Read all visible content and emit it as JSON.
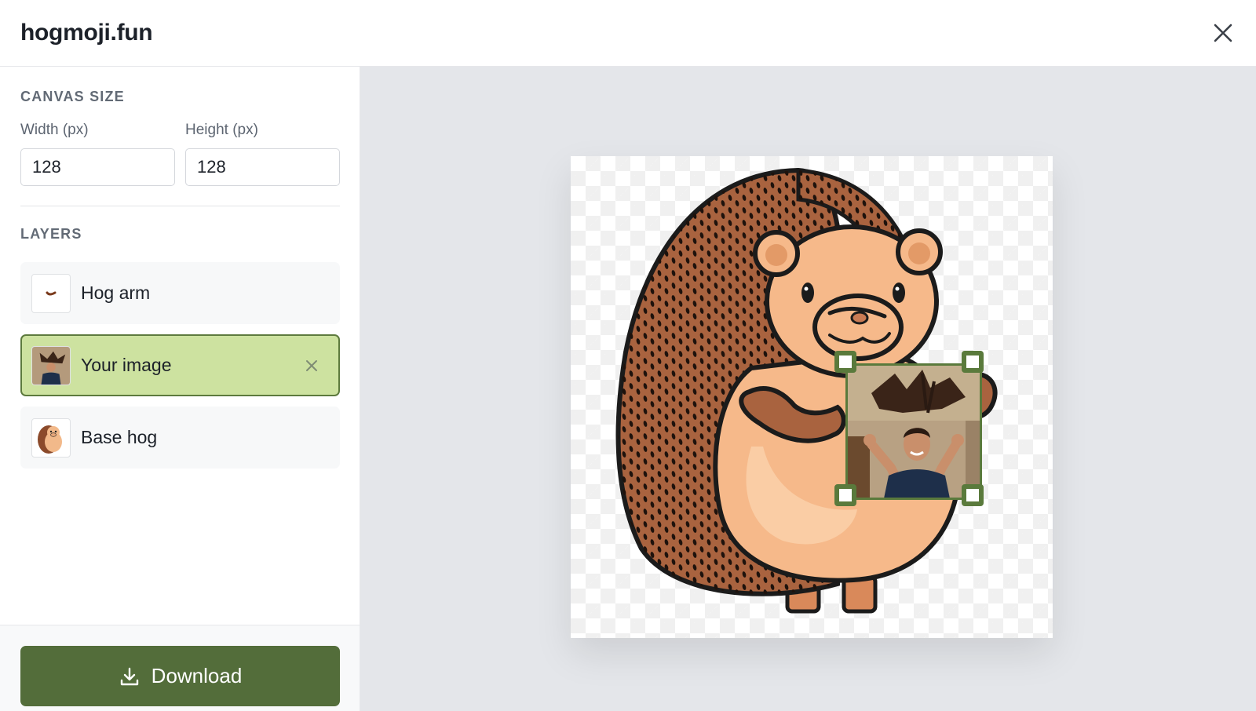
{
  "header": {
    "title": "hogmoji.fun",
    "close_icon": "close-icon"
  },
  "canvas_size": {
    "section_title": "CANVAS SIZE",
    "width_label": "Width (px)",
    "width_value": "128",
    "height_label": "Height (px)",
    "height_value": "128"
  },
  "layers": {
    "section_title": "LAYERS",
    "items": [
      {
        "label": "Hog arm",
        "selected": false
      },
      {
        "label": "Your image",
        "selected": true
      },
      {
        "label": "Base hog",
        "selected": false
      }
    ]
  },
  "footer": {
    "download_label": "Download",
    "download_icon": "download-icon"
  },
  "colors": {
    "accent": "#536d3a",
    "selected_layer_bg": "#cde2a0",
    "selection_frame": "#5a7a3c",
    "workspace_bg": "#e4e6ea"
  }
}
